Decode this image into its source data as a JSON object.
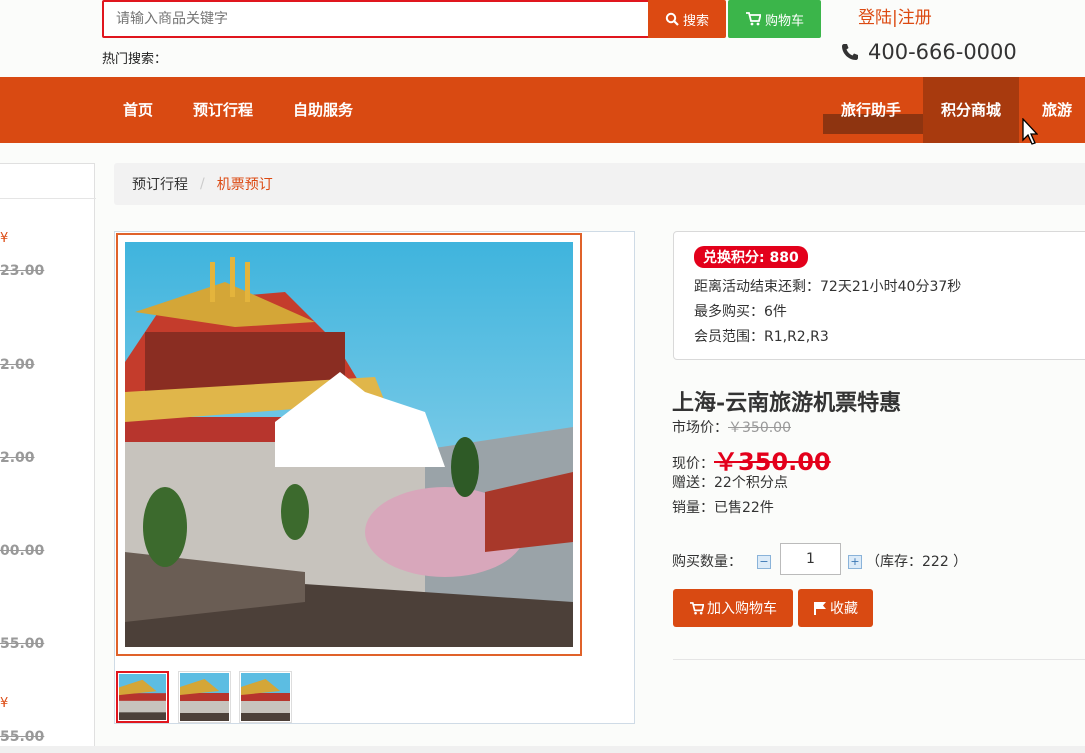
{
  "header": {
    "search_placeholder": "请输入商品关键字",
    "search_button": "搜索",
    "cart_button": "购物车",
    "hot_search_label": "热门搜索：",
    "login_register": "登陆|注册",
    "phone": "400-666-0000"
  },
  "nav": {
    "items": [
      "首页",
      "预订行程",
      "自助服务",
      "旅行助手",
      "积分商城",
      "旅游度"
    ],
    "active": "积分商城"
  },
  "sidebar": {
    "prices": [
      "23.00",
      "2.00",
      "2.00",
      "00.00",
      "55.00",
      "55.00"
    ]
  },
  "breadcrumb": {
    "parent": "预订行程",
    "separator": "/",
    "current": "机票预订"
  },
  "promo": {
    "points_badge": "兑换积分: 880",
    "countdown": "距离活动结束还剩：72天21小时40分37秒",
    "max_buy": "最多购买：6件",
    "member_scope": "会员范围：R1,R2,R3"
  },
  "product": {
    "title": "上海-云南旅游机票特惠",
    "market_label": "市场价：",
    "market_price": "￥350.00",
    "current_label": "现价：",
    "current_price": "￥350.00",
    "gift": "赠送：22个积分点",
    "sales": "销量：已售22件",
    "qty_label": "购买数量：",
    "qty_value": "1",
    "stock": "（库存：222 ）",
    "add_cart": "加入购物车",
    "favorite": "收藏"
  },
  "colors": {
    "brand": "#d94a12",
    "nav_active": "#a83a0e",
    "price_red": "#e3001b",
    "cart_green": "#3bb54a"
  }
}
